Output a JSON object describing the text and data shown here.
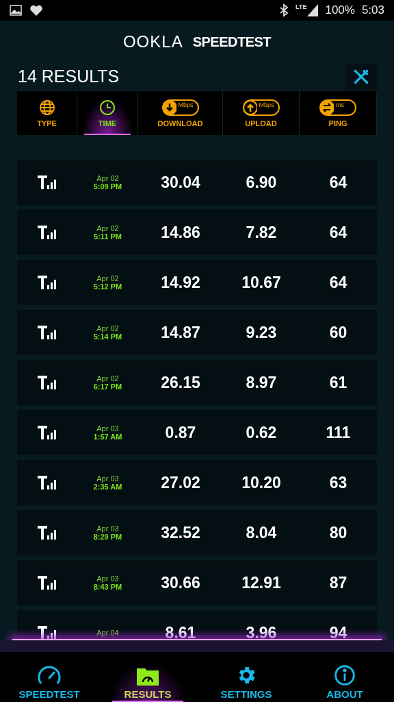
{
  "status_bar": {
    "network": "LTE",
    "battery": "100%",
    "time": "5:03"
  },
  "header": {
    "logo": "OOKLA",
    "title": "SPEEDTEST"
  },
  "results_count": "14 RESULTS",
  "columns": [
    {
      "kind": "globe",
      "label": "TYPE",
      "selected": false
    },
    {
      "kind": "clock",
      "label": "TIME",
      "selected": true
    },
    {
      "kind": "download",
      "label": "DOWNLOAD",
      "unit": "Mbps",
      "selected": false
    },
    {
      "kind": "upload",
      "label": "UPLOAD",
      "unit": "Mbps",
      "selected": false
    },
    {
      "kind": "ping",
      "label": "PING",
      "unit": "ms",
      "selected": false
    }
  ],
  "rows": [
    {
      "date": "Apr 02",
      "time": "5:09 PM",
      "download": "30.04",
      "upload": "6.90",
      "ping": "64"
    },
    {
      "date": "Apr 02",
      "time": "5:11 PM",
      "download": "14.86",
      "upload": "7.82",
      "ping": "64"
    },
    {
      "date": "Apr 02",
      "time": "5:12 PM",
      "download": "14.92",
      "upload": "10.67",
      "ping": "64"
    },
    {
      "date": "Apr 02",
      "time": "5:14 PM",
      "download": "14.87",
      "upload": "9.23",
      "ping": "60"
    },
    {
      "date": "Apr 02",
      "time": "6:17 PM",
      "download": "26.15",
      "upload": "8.97",
      "ping": "61"
    },
    {
      "date": "Apr 03",
      "time": "1:57 AM",
      "download": "0.87",
      "upload": "0.62",
      "ping": "111"
    },
    {
      "date": "Apr 03",
      "time": "2:35 AM",
      "download": "27.02",
      "upload": "10.20",
      "ping": "63"
    },
    {
      "date": "Apr 03",
      "time": "8:29 PM",
      "download": "32.52",
      "upload": "8.04",
      "ping": "80"
    },
    {
      "date": "Apr 03",
      "time": "8:43 PM",
      "download": "30.66",
      "upload": "12.91",
      "ping": "87"
    },
    {
      "date": "Apr 04",
      "download": "8.61",
      "upload": "3.96",
      "ping": "94"
    }
  ],
  "nav": [
    {
      "kind": "gauge",
      "label": "SPEEDTEST",
      "selected": false
    },
    {
      "kind": "folder",
      "label": "RESULTS",
      "selected": true
    },
    {
      "kind": "gear",
      "label": "SETTINGS",
      "selected": false
    },
    {
      "kind": "info",
      "label": "ABOUT",
      "selected": false
    }
  ]
}
